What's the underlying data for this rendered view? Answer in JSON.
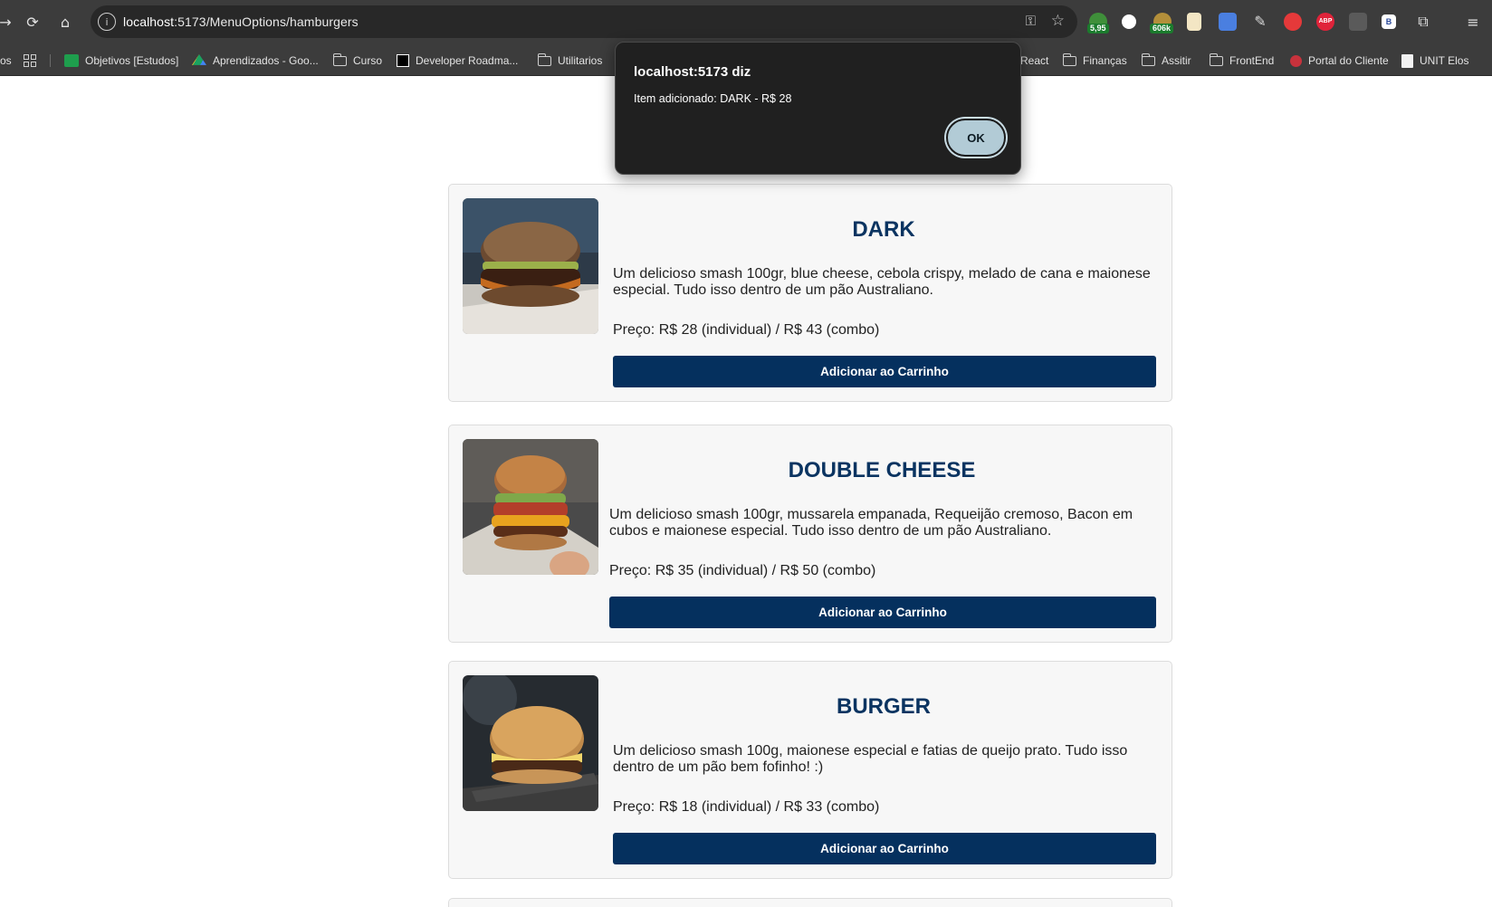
{
  "browser": {
    "url_host": "localhost",
    "url_path": ":5173/MenuOptions/hamburgers",
    "extension_badges": {
      "one": "5,95",
      "two": "606k",
      "abp": "ABP",
      "b": "B"
    }
  },
  "bookmarks": [
    {
      "label": "Objetivos [Estudos]",
      "icon": "sheets-icon"
    },
    {
      "label": "Aprendizados - Goo...",
      "icon": "drive-icon"
    },
    {
      "label": "Curso",
      "icon": "folder-icon"
    },
    {
      "label": "Developer Roadma...",
      "icon": "roadmap-icon"
    },
    {
      "label": "Utilitarios",
      "icon": "folder-icon"
    },
    {
      "label": "React",
      "icon": "folder-icon"
    },
    {
      "label": "Finanças",
      "icon": "folder-icon"
    },
    {
      "label": "Assitir",
      "icon": "folder-icon"
    },
    {
      "label": "FrontEnd",
      "icon": "folder-icon"
    },
    {
      "label": "Portal do Cliente",
      "icon": "portal-icon"
    },
    {
      "label": "UNIT Elos",
      "icon": "doc-icon"
    }
  ],
  "bookmarks_left_fragment": "os",
  "dialog": {
    "title": "localhost:5173 diz",
    "message": "Item adicionado: DARK - R$ 28",
    "ok_label": "OK"
  },
  "menu": [
    {
      "name": "DARK",
      "description": "Um delicioso smash 100gr, blue cheese, cebola crispy, melado de cana e maionese especial. Tudo isso dentro de um pão Australiano.",
      "price": "Preço: R$ 28 (individual) / R$ 43 (combo)",
      "button": "Adicionar ao Carrinho"
    },
    {
      "name": "DOUBLE CHEESE",
      "description": "Um delicioso smash 100gr, mussarela empanada, Requeijão cremoso, Bacon em cubos e maionese especial. Tudo isso dentro de um pão Australiano.",
      "price": "Preço: R$ 35 (individual) / R$ 50 (combo)",
      "button": "Adicionar ao Carrinho"
    },
    {
      "name": "BURGER",
      "description": "Um delicioso smash 100g, maionese especial e fatias de queijo prato. Tudo isso dentro de um pão bem fofinho! :)",
      "price": "Preço: R$ 18 (individual) / R$ 33 (combo)",
      "button": "Adicionar ao Carrinho"
    }
  ],
  "colors": {
    "accent": "#05305e",
    "title": "#0b3461",
    "card_bg": "#f7f7f7",
    "chrome_bg": "#3c3c3c"
  }
}
